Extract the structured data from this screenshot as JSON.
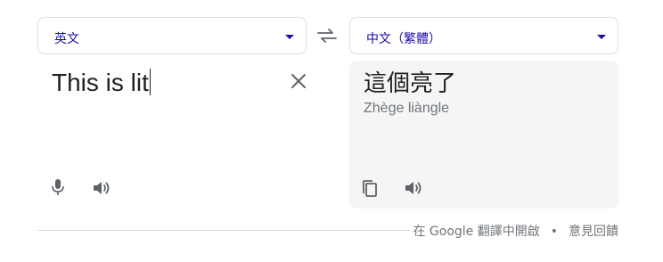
{
  "source_language": {
    "label": "英文"
  },
  "target_language": {
    "label": "中文（繁體）"
  },
  "source": {
    "text": "This is lit"
  },
  "target": {
    "text": "這個亮了",
    "romanization": "Zhège liàngle"
  },
  "footer": {
    "open_in_translate": "在 Google 翻譯中開啟",
    "separator": "•",
    "feedback": "意見回饋"
  },
  "icons": {
    "swap": "swap-arrows-icon",
    "clear": "close-icon",
    "mic": "microphone-icon",
    "speaker": "speaker-icon",
    "copy": "copy-icon"
  },
  "colors": {
    "link": "#1a0dab",
    "icon": "#5f6368",
    "panel_bg": "#f5f5f5",
    "muted_text": "#70757a"
  }
}
